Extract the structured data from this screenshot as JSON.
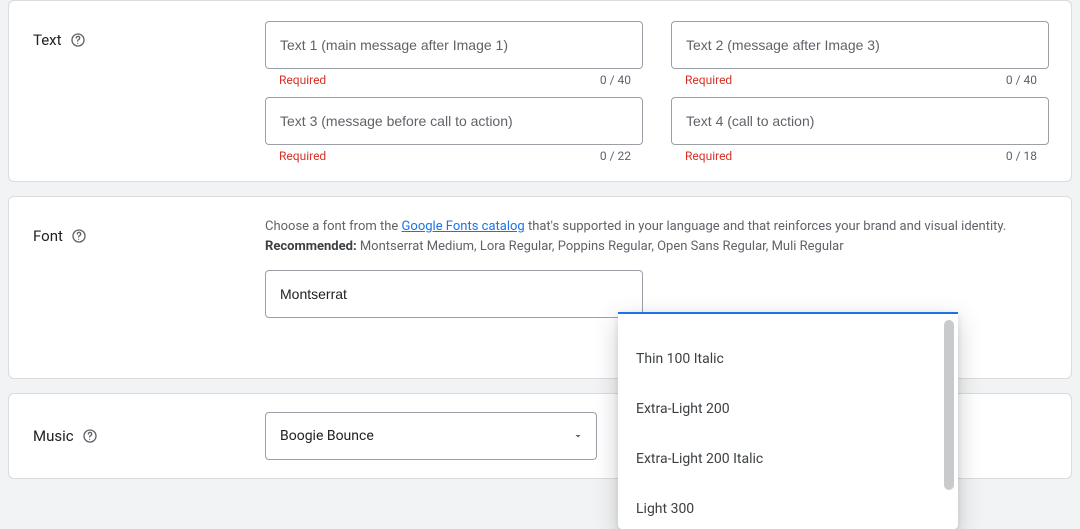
{
  "text_section": {
    "label": "Text",
    "required_label": "Required",
    "fields": [
      {
        "placeholder": "Text 1 (main message after Image 1)",
        "count": "0 / 40"
      },
      {
        "placeholder": "Text 2 (message after Image 3)",
        "count": "0 / 40"
      },
      {
        "placeholder": "Text 3 (message before call to action)",
        "count": "0 / 22"
      },
      {
        "placeholder": "Text 4 (call to action)",
        "count": "0 / 18"
      }
    ]
  },
  "font_section": {
    "label": "Font",
    "desc_prefix": "Choose a font from the ",
    "desc_link_text": "Google Fonts catalog",
    "desc_suffix": " that's supported in your language and that reinforces your brand and visual identity.",
    "recommended_label": "Recommended:",
    "recommended_values": " Montserrat Medium, Lora Regular, Poppins Regular, Open Sans Regular, Muli Regular",
    "selected_family": "Montserrat",
    "weight_options": [
      "Thin 100 Italic",
      "Extra-Light 200",
      "Extra-Light 200 Italic",
      "Light 300"
    ]
  },
  "music_section": {
    "label": "Music",
    "selected_track": "Boogie Bounce"
  },
  "colors": {
    "link": "#1a73e8",
    "error": "#d93025",
    "border": "#9aa0a6"
  }
}
